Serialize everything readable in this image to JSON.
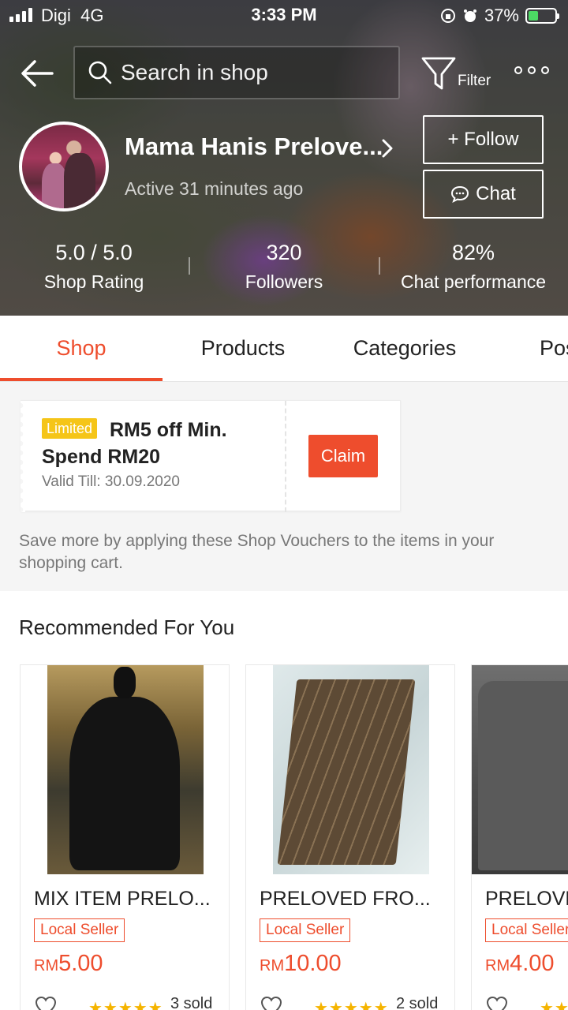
{
  "status_bar": {
    "carrier": "Digi",
    "network": "4G",
    "time": "3:33 PM",
    "battery_percent": "37%",
    "battery_level": 0.37
  },
  "search": {
    "placeholder": "Search in shop"
  },
  "filter": {
    "label": "Filter"
  },
  "shop": {
    "name": "Mama Hanis Prelove...",
    "active_status": "Active 31 minutes ago",
    "follow_label": "+ Follow",
    "chat_label": "Chat",
    "stats": [
      {
        "value": "5.0 / 5.0",
        "label": "Shop Rating"
      },
      {
        "value": "320",
        "label": "Followers"
      },
      {
        "value": "82%",
        "label": "Chat performance"
      }
    ]
  },
  "tabs": [
    {
      "label": "Shop"
    },
    {
      "label": "Products"
    },
    {
      "label": "Categories"
    },
    {
      "label": "Pos"
    }
  ],
  "voucher": {
    "badge": "Limited",
    "title": "RM5 off Min. Spend RM20",
    "valid": "Valid Till: 30.09.2020",
    "claim_label": "Claim"
  },
  "voucher_note": "Save more by applying these Shop Vouchers to the items in your shopping cart.",
  "recommended": {
    "title": "Recommended For You",
    "products": [
      {
        "name": "MIX ITEM PRELO...",
        "badge": "Local Seller",
        "currency": "RM",
        "price": "5.00",
        "rating": "★★★★★",
        "sold": "3 sold"
      },
      {
        "name": "PRELOVED FRO...",
        "badge": "Local Seller",
        "currency": "RM",
        "price": "10.00",
        "rating": "★★★★★",
        "sold": "2 sold"
      },
      {
        "name": "PRELOVED",
        "badge": "Local Seller",
        "currency": "RM",
        "price": "4.00",
        "rating": "★★★★★",
        "sold": ""
      }
    ]
  },
  "colors": {
    "accent": "#ee4d2d",
    "badge_yellow": "#f5c518",
    "battery_green": "#4cd964",
    "star": "#f5b400"
  }
}
